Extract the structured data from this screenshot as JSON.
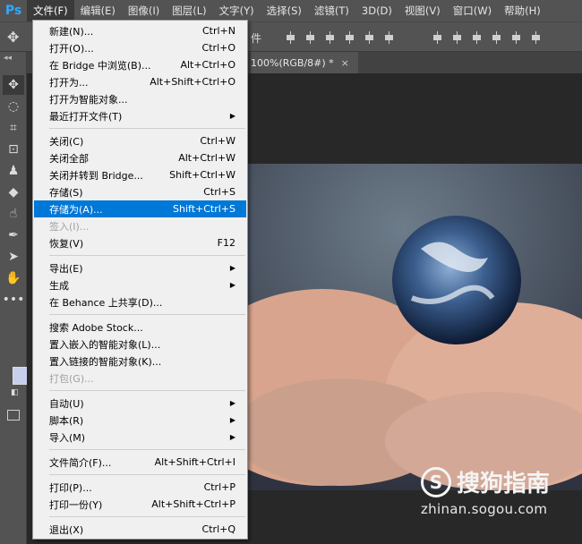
{
  "app": {
    "logo": "Ps"
  },
  "menubar": {
    "items": [
      "文件(F)",
      "编辑(E)",
      "图像(I)",
      "图层(L)",
      "文字(Y)",
      "选择(S)",
      "滤镜(T)",
      "3D(D)",
      "视图(V)",
      "窗口(W)",
      "帮助(H)"
    ]
  },
  "options_bar": {
    "partial_text": "件"
  },
  "document_tab": {
    "title": "100%(RGB/8#) *",
    "close_glyph": "×"
  },
  "toolbar": {
    "collapse_glyph": "◂◂",
    "foreground_color": "#c6d0ec"
  },
  "file_menu": {
    "items": [
      {
        "label": "新建(N)...",
        "shortcut": "Ctrl+N"
      },
      {
        "label": "打开(O)...",
        "shortcut": "Ctrl+O"
      },
      {
        "label": "在 Bridge 中浏览(B)...",
        "shortcut": "Alt+Ctrl+O"
      },
      {
        "label": "打开为...",
        "shortcut": "Alt+Shift+Ctrl+O"
      },
      {
        "label": "打开为智能对象...",
        "shortcut": ""
      },
      {
        "label": "最近打开文件(T)",
        "shortcut": "",
        "submenu": true
      },
      {
        "label": "关闭(C)",
        "shortcut": "Ctrl+W"
      },
      {
        "label": "关闭全部",
        "shortcut": "Alt+Ctrl+W"
      },
      {
        "label": "关闭并转到 Bridge...",
        "shortcut": "Shift+Ctrl+W"
      },
      {
        "label": "存储(S)",
        "shortcut": "Ctrl+S"
      },
      {
        "label": "存储为(A)...",
        "shortcut": "Shift+Ctrl+S",
        "highlighted": true
      },
      {
        "label": "签入(I)...",
        "shortcut": "",
        "disabled": true
      },
      {
        "label": "恢复(V)",
        "shortcut": "F12"
      },
      {
        "label": "导出(E)",
        "shortcut": "",
        "submenu": true
      },
      {
        "label": "生成",
        "shortcut": "",
        "submenu": true
      },
      {
        "label": "在 Behance 上共享(D)...",
        "shortcut": ""
      },
      {
        "label": "搜索 Adobe Stock...",
        "shortcut": ""
      },
      {
        "label": "置入嵌入的智能对象(L)...",
        "shortcut": ""
      },
      {
        "label": "置入链接的智能对象(K)...",
        "shortcut": ""
      },
      {
        "label": "打包(G)...",
        "shortcut": "",
        "disabled": true
      },
      {
        "label": "自动(U)",
        "shortcut": "",
        "submenu": true
      },
      {
        "label": "脚本(R)",
        "shortcut": "",
        "submenu": true
      },
      {
        "label": "导入(M)",
        "shortcut": "",
        "submenu": true
      },
      {
        "label": "文件简介(F)...",
        "shortcut": "Alt+Shift+Ctrl+I"
      },
      {
        "label": "打印(P)...",
        "shortcut": "Ctrl+P"
      },
      {
        "label": "打印一份(Y)",
        "shortcut": "Alt+Shift+Ctrl+P"
      },
      {
        "label": "退出(X)",
        "shortcut": "Ctrl+Q"
      }
    ],
    "submenu_glyph": "▶"
  },
  "watermark": {
    "brand": "搜狗指南",
    "logo_letter": "S",
    "url": "zhinan.sogou.com"
  },
  "colors": {
    "highlight": "#0078d7",
    "menu_bg": "#f0f0f0",
    "chrome": "#535353"
  }
}
